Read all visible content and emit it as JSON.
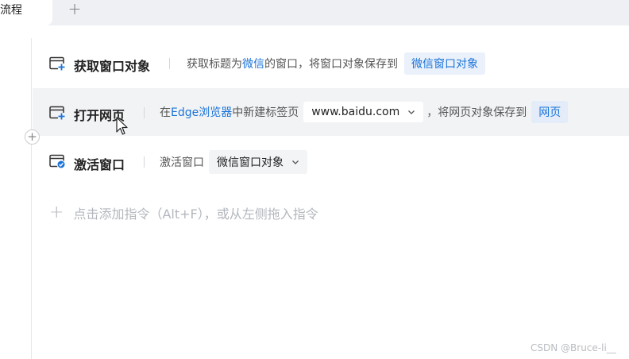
{
  "tabs": {
    "active_label": "流程",
    "add_symbol": "+"
  },
  "add_between_symbol": "+",
  "steps": [
    {
      "title": "获取窗口对象",
      "icon": "window-plus-icon",
      "desc_prefix": "获取标题为",
      "desc_highlight": "微信",
      "desc_middle": "的窗口，将窗口对象保存到",
      "var_chip": "微信窗口对象"
    },
    {
      "title": "打开网页",
      "icon": "window-plus-icon",
      "desc_prefix": "在",
      "desc_highlight": "Edge浏览器",
      "desc_middle": "中新建标签页",
      "url_value": "www.baidu.com",
      "desc_suffix": "，将网页对象保存到",
      "var_chip": "网页"
    },
    {
      "title": "激活窗口",
      "icon": "window-check-icon",
      "desc_prefix": "激活窗口",
      "select_value": "微信窗口对象"
    }
  ],
  "add_hint": {
    "plus": "+",
    "text": "点击添加指令（Alt+F），或从左侧拖入指令"
  },
  "watermark": "CSDN @Bruce-li__",
  "colors": {
    "accent": "#1a73d9",
    "hover_row": "#f2f3f5",
    "chip_bg": "#eaf1fb"
  }
}
